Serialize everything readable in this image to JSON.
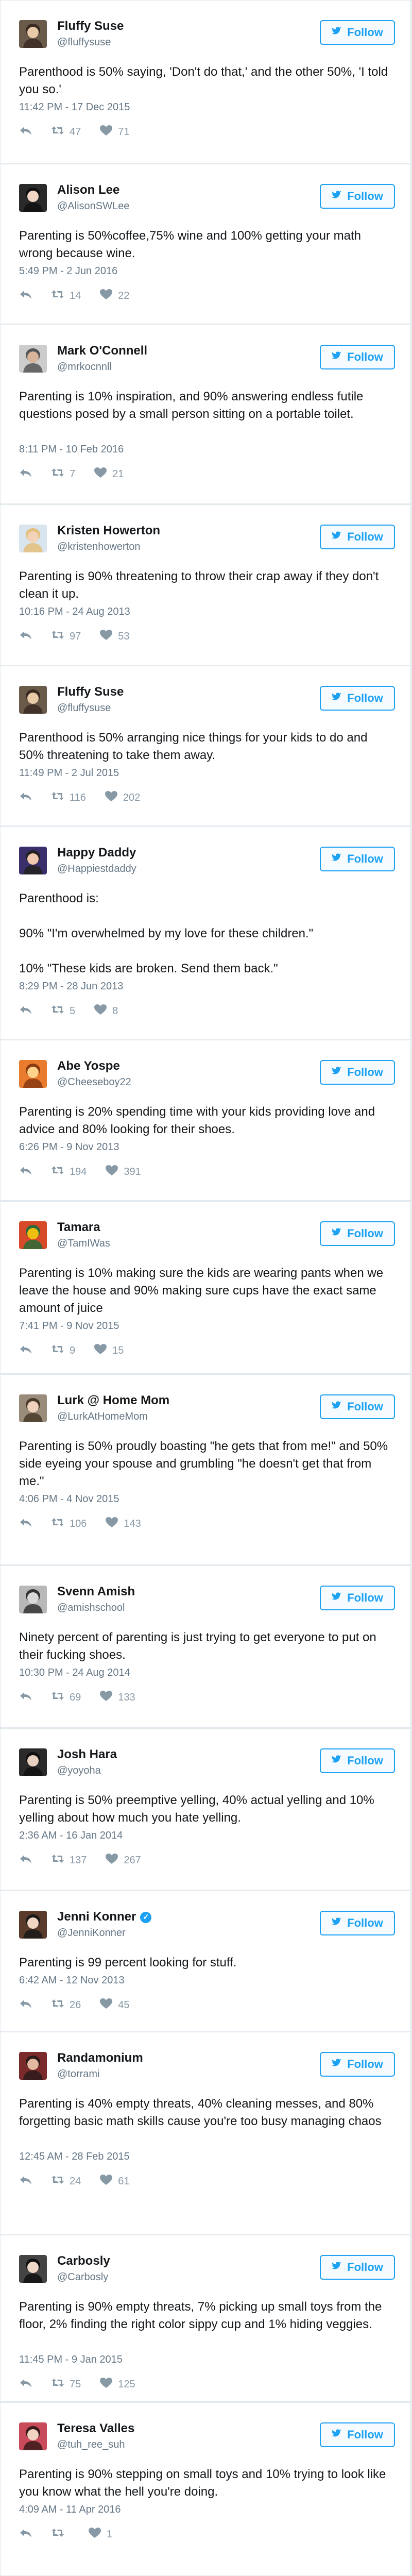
{
  "follow_label": "Follow",
  "colors": {
    "accent": "#1da1f2",
    "text": "#14171a",
    "muted": "#657786",
    "border": "#e1e8ed",
    "background": "#e6ecf0"
  },
  "icons": {
    "reply": "reply-icon",
    "retweet": "retweet-icon",
    "like": "heart-icon",
    "follow": "twitter-bird-icon"
  },
  "tweets": [
    {
      "name": "Fluffy Suse",
      "handle": "@fluffysuse",
      "verified": false,
      "text": [
        "Parenthood is 50% saying, 'Don't do that,' and the other 50%, 'I told you so.'"
      ],
      "timestamp": "11:42 PM - 17 Dec 2015",
      "retweets": "47",
      "likes": "71"
    },
    {
      "name": "Alison Lee",
      "handle": "@AlisonSWLee",
      "verified": false,
      "text": [
        "Parenting is 50%coffee,75% wine and 100% getting your math wrong because wine."
      ],
      "timestamp": "5:49 PM - 2 Jun 2016",
      "retweets": "14",
      "likes": "22"
    },
    {
      "name": "Mark O'Connell",
      "handle": "@mrkocnnll",
      "verified": false,
      "text": [
        "Parenting is 10% inspiration, and 90% answering endless futile questions posed by a small person sitting on a portable toilet."
      ],
      "timestamp": "8:11 PM - 10 Feb 2016",
      "retweets": "7",
      "likes": "21"
    },
    {
      "name": "Kristen Howerton",
      "handle": "@kristenhowerton",
      "verified": false,
      "text": [
        "Parenting is 90% threatening to throw their crap away if they don't clean it up."
      ],
      "timestamp": "10:16 PM - 24 Aug 2013",
      "retweets": "97",
      "likes": "53"
    },
    {
      "name": "Fluffy Suse",
      "handle": "@fluffysuse",
      "verified": false,
      "text": [
        "Parenthood is 50% arranging nice things for your kids to do and 50% threatening to take them away."
      ],
      "timestamp": "11:49 PM - 2 Jul 2015",
      "retweets": "116",
      "likes": "202"
    },
    {
      "name": "Happy Daddy",
      "handle": "@Happiestdaddy",
      "verified": false,
      "text": [
        "Parenthood is:",
        "90% \"I'm overwhelmed by my love for these children.\"",
        "10% \"These kids are broken. Send them back.\""
      ],
      "timestamp": "8:29 PM - 28 Jun 2013",
      "retweets": "5",
      "likes": "8"
    },
    {
      "name": "Abe Yospe",
      "handle": "@Cheeseboy22",
      "verified": false,
      "text": [
        "Parenting is 20% spending time with your kids providing love and advice and 80% looking for their shoes."
      ],
      "timestamp": "6:26 PM - 9 Nov 2013",
      "retweets": "194",
      "likes": "391"
    },
    {
      "name": "Tamara",
      "handle": "@TamIWas",
      "verified": false,
      "text": [
        "Parenting is 10% making sure the kids are wearing pants when we leave the house and 90% making sure cups have the exact same amount of juice"
      ],
      "timestamp": "7:41 PM - 9 Nov 2015",
      "retweets": "9",
      "likes": "15"
    },
    {
      "name": "Lurk @ Home Mom",
      "handle": "@LurkAtHomeMom",
      "verified": false,
      "text": [
        "Parenting is 50% proudly boasting \"he gets that from me!\" and 50% side eyeing your spouse and grumbling \"he doesn't get that from me.\""
      ],
      "timestamp": "4:06 PM - 4 Nov 2015",
      "retweets": "106",
      "likes": "143"
    },
    {
      "name": "Svenn Amish",
      "handle": "@amishschool",
      "verified": false,
      "text": [
        "Ninety percent of parenting is just trying to get everyone to put on their fucking shoes."
      ],
      "timestamp": "10:30 PM - 24 Aug 2014",
      "retweets": "69",
      "likes": "133"
    },
    {
      "name": "Josh Hara",
      "handle": "@yoyoha",
      "verified": false,
      "text": [
        "Parenting is 50% preemptive yelling, 40% actual yelling and 10% yelling about how much you hate yelling."
      ],
      "timestamp": "2:36 AM - 16 Jan 2014",
      "retweets": "137",
      "likes": "267"
    },
    {
      "name": "Jenni Konner",
      "handle": "@JenniKonner",
      "verified": true,
      "text": [
        "Parenting is 99 percent looking for stuff."
      ],
      "timestamp": "6:42 AM - 12 Nov 2013",
      "retweets": "26",
      "likes": "45"
    },
    {
      "name": "Randamonium",
      "handle": "@torrami",
      "verified": false,
      "text": [
        "Parenting is 40% empty threats, 40% cleaning messes, and 80% forgetting basic math skills cause you're too busy managing chaos"
      ],
      "timestamp": "12:45 AM - 28 Feb 2015",
      "retweets": "24",
      "likes": "61"
    },
    {
      "name": "Carbosly",
      "handle": "@Carbosly",
      "verified": false,
      "text": [
        "Parenting is 90% empty threats, 7% picking up small toys from the floor, 2% finding the right color sippy cup and 1% hiding veggies."
      ],
      "timestamp": "11:45 PM - 9 Jan 2015",
      "retweets": "75",
      "likes": "125"
    },
    {
      "name": "Teresa Valles",
      "handle": "@tuh_ree_suh",
      "verified": false,
      "text": [
        "Parenting is 90% stepping on small toys and 10% trying to look like you know what the hell you're doing."
      ],
      "timestamp": "4:09 AM - 11 Apr 2016",
      "retweets": "",
      "likes": "1"
    }
  ]
}
